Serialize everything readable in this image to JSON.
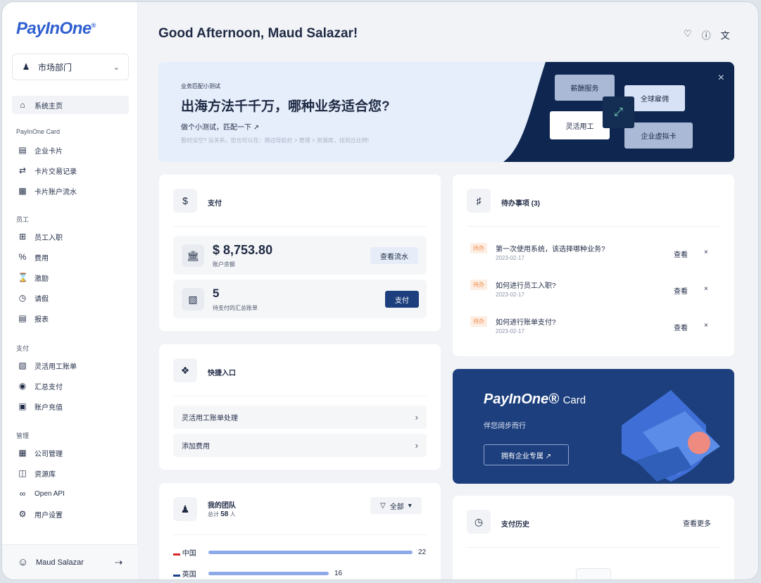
{
  "brand": {
    "logo": "PayInOne",
    "mark": "®"
  },
  "department": {
    "label": "市场部门"
  },
  "nav": {
    "home": "系统主页",
    "section_card": "PayInOne Card",
    "card_items": [
      "企业卡片",
      "卡片交易记录",
      "卡片账户流水"
    ],
    "section_staff": "员工",
    "staff_items": [
      "员工入职",
      "费用",
      "激励",
      "请假",
      "报表"
    ],
    "section_pay": "支付",
    "pay_items": [
      "灵活用工账单",
      "汇总支付",
      "账户充值"
    ],
    "section_manage": "管理",
    "manage_items": [
      "公司管理",
      "资源库",
      "Open API",
      "用户设置"
    ]
  },
  "user": {
    "name": "Maud Salazar"
  },
  "header": {
    "greeting": "Good Afternoon, Maud Salazar!"
  },
  "banner": {
    "kicker": "业务匹配小测试",
    "title": "出海方法千千万，哪种业务适合您?",
    "cta": "做个小测试，匹配一下 ↗",
    "hint": "暂时没空? 没关系。您也可以在：侧边导航栏 > 管理 > 资源库，找到丘比特!",
    "tags": [
      "薪酬服务",
      "全球雇佣",
      "灵活用工",
      "企业虚拟卡"
    ]
  },
  "payment": {
    "title": "支付",
    "balance": "$ 8,753.80",
    "balance_label": "账户余额",
    "view_flow": "查看流水",
    "pending_count": "5",
    "pending_label": "待支付的汇总账单",
    "pay_button": "支付"
  },
  "quick": {
    "title": "快捷入口",
    "items": [
      "灵活用工账单处理",
      "添加费用"
    ]
  },
  "team": {
    "title": "我的团队",
    "total_prefix": "总计",
    "total": "58",
    "total_suffix": "人",
    "filter": "全部",
    "rows": [
      {
        "country": "中国",
        "count": "22",
        "share": 1.0
      },
      {
        "country": "英国",
        "count": "16",
        "share": 0.59
      }
    ]
  },
  "todo": {
    "title": "待办事项 (3)",
    "badge": "待办",
    "view": "查看",
    "close": "×",
    "items": [
      {
        "text": "第一次使用系统，该选择哪种业务?",
        "date": "2023-02-17"
      },
      {
        "text": "如何进行员工入职?",
        "date": "2023-02-17"
      },
      {
        "text": "如何进行账单支付?",
        "date": "2023-02-17"
      }
    ]
  },
  "promo": {
    "brand": "PayInOne",
    "brand_suffix": "Card",
    "subtitle": "伴您阔步而行",
    "button": "拥有企业专属 ↗"
  },
  "history": {
    "title": "支付历史",
    "more": "查看更多"
  },
  "colors": {
    "primary": "#1d3f7d",
    "accent": "#2f5fd0",
    "badge": "#f08a45"
  }
}
